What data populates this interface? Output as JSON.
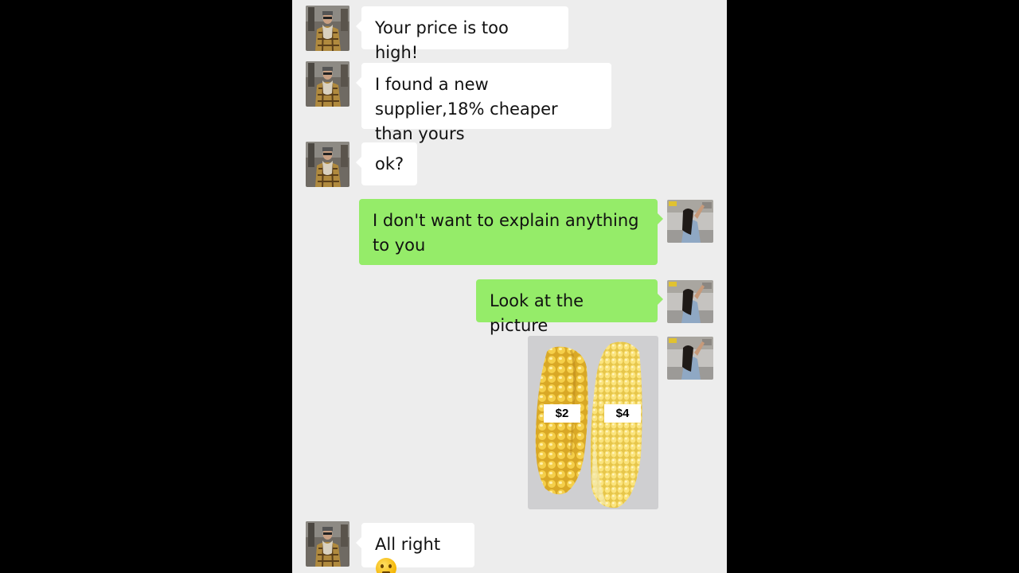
{
  "chat": {
    "messages": [
      {
        "side": "in",
        "text": "Your price is too high!"
      },
      {
        "side": "in",
        "text": "I found a new supplier,18% cheaper than yours"
      },
      {
        "side": "in",
        "text": "ok?"
      },
      {
        "side": "out",
        "text": "I don't want to explain anything to you"
      },
      {
        "side": "out",
        "text": "Look at the picture"
      },
      {
        "side": "out",
        "type": "image",
        "icon": "corn-photo",
        "labels": [
          "$2",
          "$4"
        ]
      },
      {
        "side": "in",
        "text": "All right",
        "emoji": "thinking-face-icon"
      }
    ]
  },
  "colors": {
    "background": "#ededed",
    "incoming_bubble": "#ffffff",
    "outgoing_bubble": "#95ec69"
  }
}
